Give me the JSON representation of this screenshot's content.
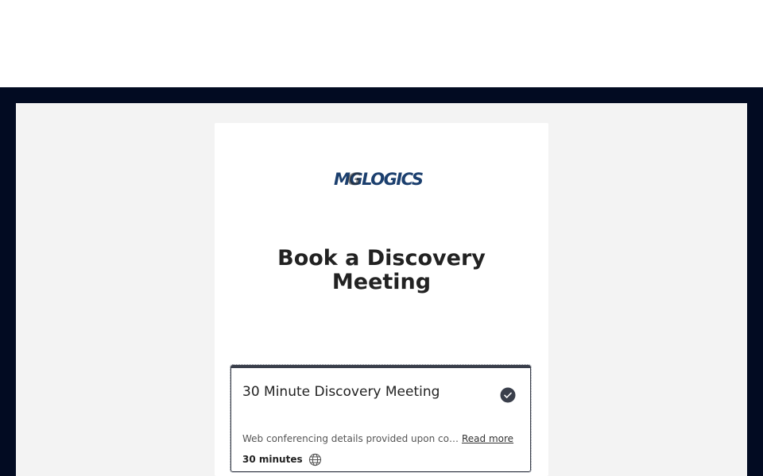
{
  "brand": {
    "logo_text": "MGLOGICS",
    "logo_color": "#1b3f6e",
    "logo_accent_color": "#2a2a2a"
  },
  "page": {
    "heading": "Book a Discovery Meeting"
  },
  "meeting_option": {
    "title": "30 Minute Discovery Meeting",
    "selected": true,
    "description": "Web conferencing details provided upon confirmation.",
    "read_more_label": "Read more",
    "duration": "30 minutes",
    "timezone_icon": "globe-icon",
    "selected_icon": "check-circle-icon"
  },
  "colors": {
    "frame": "#020b22",
    "panel": "#f3f3f3",
    "card": "#ffffff",
    "accent": "#3a3f4b"
  }
}
